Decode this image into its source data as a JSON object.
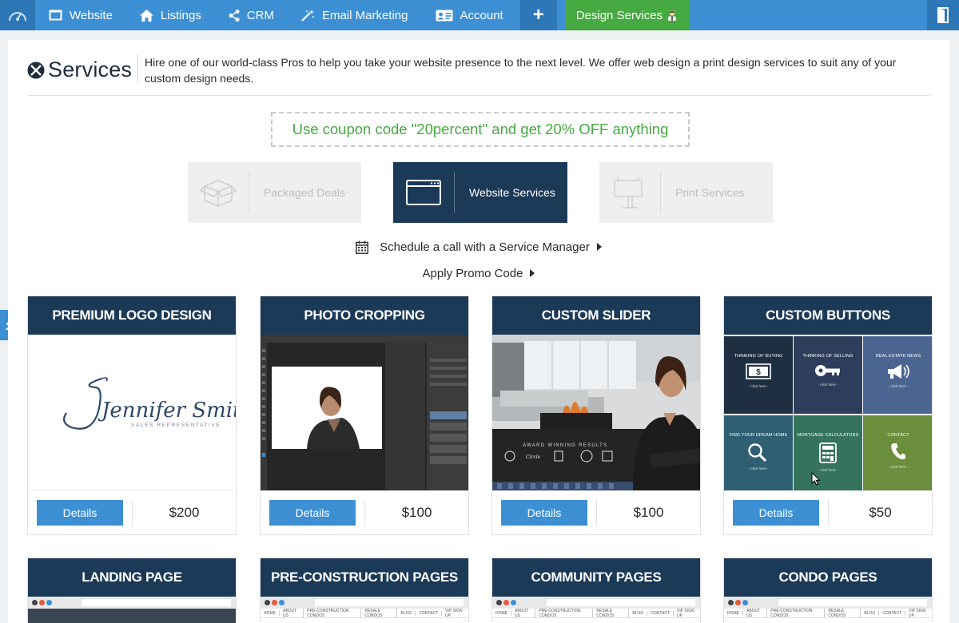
{
  "nav": {
    "items": [
      {
        "label": "Website",
        "icon": "browser-window-icon"
      },
      {
        "label": "Listings",
        "icon": "home-icon"
      },
      {
        "label": "CRM",
        "icon": "share-icon"
      },
      {
        "label": "Email Marketing",
        "icon": "magic-wand-icon"
      },
      {
        "label": "Account",
        "icon": "id-card-icon"
      }
    ],
    "plus_label": "+",
    "design_services_label": "Design Services",
    "colors": {
      "bar": "#3d8fd4",
      "dark": "#2d77b7",
      "green": "#46a941"
    }
  },
  "header": {
    "title": "Services",
    "description": "Hire one of our world-class Pros to help you take your website presence to the next level. We offer web design a print design services to suit any of your custom design needs."
  },
  "coupon_text": "Use coupon code \"20percent\" and get 20% OFF anything",
  "service_tabs": [
    {
      "label": "Packaged Deals",
      "icon": "box-icon",
      "active": false
    },
    {
      "label": "Website Services",
      "icon": "browser-window-icon",
      "active": true
    },
    {
      "label": "Print Services",
      "icon": "sign-post-icon",
      "active": false
    }
  ],
  "links": {
    "schedule": "Schedule a call with a Service Manager",
    "promo": "Apply Promo Code"
  },
  "cards": [
    {
      "title": "PREMIUM LOGO DESIGN",
      "price": "$200",
      "button": "Details"
    },
    {
      "title": "PHOTO CROPPING",
      "price": "$100",
      "button": "Details"
    },
    {
      "title": "CUSTOM SLIDER",
      "price": "$100",
      "button": "Details"
    },
    {
      "title": "CUSTOM BUTTONS",
      "price": "$50",
      "button": "Details"
    },
    {
      "title": "LANDING PAGE"
    },
    {
      "title": "PRE-CONSTRUCTION PAGES"
    },
    {
      "title": "COMMUNITY PAGES"
    },
    {
      "title": "CONDO PAGES"
    }
  ],
  "logo_card": {
    "name": "Jennifer Smith",
    "tagline": "SALES REPRESENTATIVE"
  },
  "slider_card": {
    "caption": "AWARD WINNING RESULTS"
  },
  "custom_buttons": [
    {
      "label": "THINKING OF BUYING",
      "sub": "- click here -",
      "color": "#1e2f42"
    },
    {
      "label": "THINKING OF SELLING",
      "sub": "- click here -",
      "color": "#2d3e5c"
    },
    {
      "label": "REAL ESTATE NEWS",
      "sub": "- click here -",
      "color": "#4a6591"
    },
    {
      "label": "FIND YOUR DREAM HOME",
      "sub": "- click here -",
      "color": "#2f5f73"
    },
    {
      "label": "MORTGAGE CALCULATORS",
      "sub": "- click here -",
      "color": "#35735c"
    },
    {
      "label": "CONTACT",
      "sub": "- click here -",
      "color": "#6b8e3d"
    }
  ],
  "mini_nav": [
    "HOME",
    "ABOUT US",
    "PRE-CONSTRUCTION CONDOS",
    "RESALE CONDOS",
    "BLOG",
    "CONTACT",
    "VIP SIGN UP"
  ]
}
